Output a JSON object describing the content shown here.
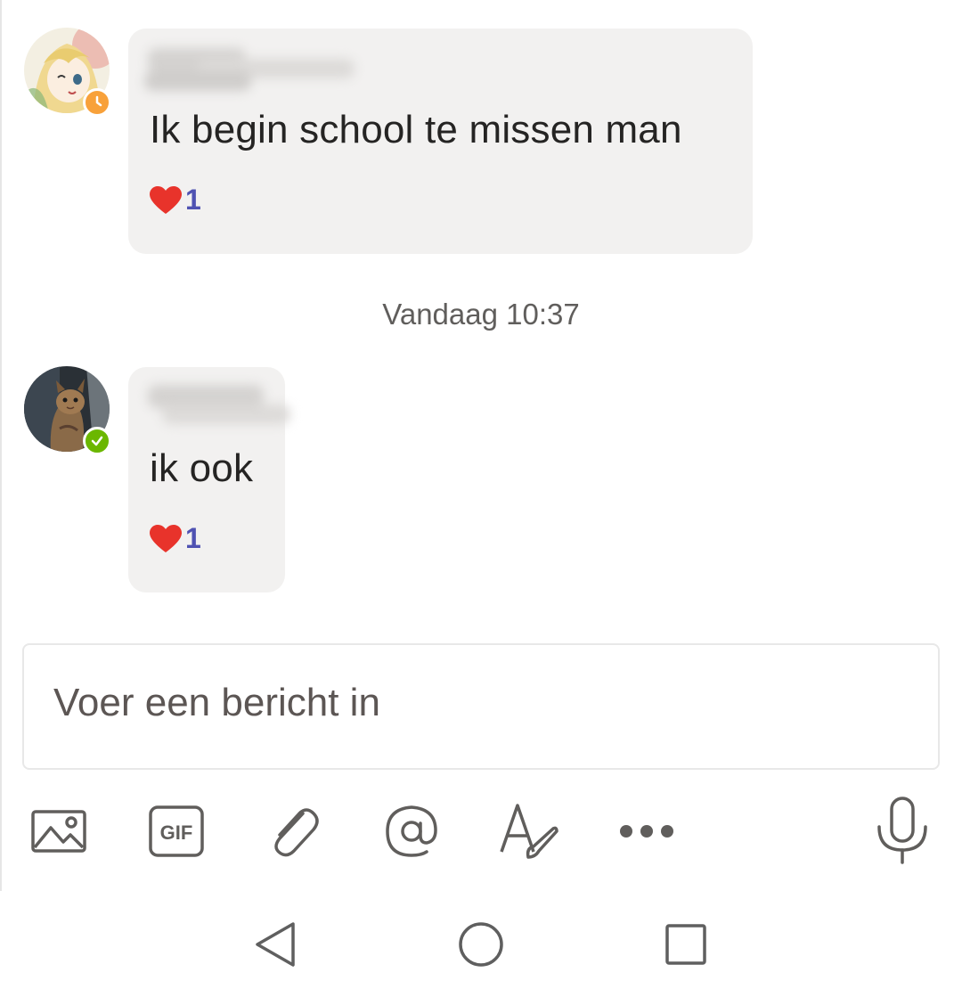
{
  "messages": [
    {
      "text": "Ik begin school te missen man",
      "reaction_count": "1",
      "avatar_status": "away",
      "reaction_icon": "heart-icon"
    },
    {
      "text": "ik ook",
      "reaction_count": "1",
      "avatar_status": "available",
      "reaction_icon": "heart-icon"
    }
  ],
  "timestamp": "Vandaag 10:37",
  "compose": {
    "placeholder": "Voer een bericht in"
  },
  "toolbar": {
    "icons": [
      "image-icon",
      "gif-icon",
      "attach-icon",
      "mention-icon",
      "format-icon",
      "more-icon",
      "microphone-icon"
    ],
    "gif_label": "GIF"
  },
  "navbar": {
    "icons": [
      "back-icon",
      "home-icon",
      "recents-icon"
    ]
  },
  "colors": {
    "bubble": "#f2f1f0",
    "reaction_count": "#4f52b2",
    "heart": "#e8332b",
    "status_away": "#f8a13a",
    "status_available": "#6bb700",
    "icon": "#605e5c"
  }
}
